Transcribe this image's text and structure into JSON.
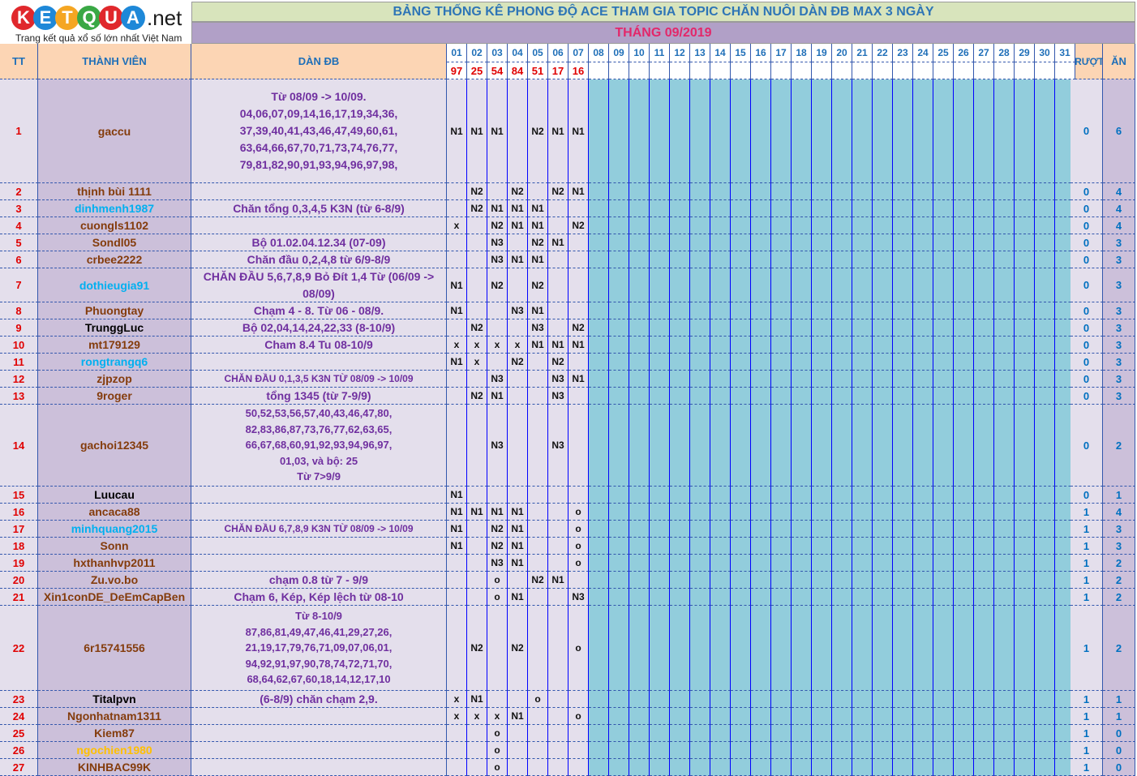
{
  "logo": {
    "letters": [
      {
        "ch": "K",
        "color": "#e0282c"
      },
      {
        "ch": "E",
        "color": "#1e88d8"
      },
      {
        "ch": "T",
        "color": "#f5a623"
      },
      {
        "ch": "Q",
        "color": "#3aa845"
      },
      {
        "ch": "U",
        "color": "#e0282c"
      },
      {
        "ch": "A",
        "color": "#1e88d8"
      }
    ],
    "suffix": ".net",
    "tagline": "Trang kết quả xổ số lớn nhất Việt Nam"
  },
  "title": "BẢNG THỐNG KÊ PHONG ĐỘ ACE THAM GIA TOPIC CHĂN NUÔI DÀN ĐB MAX 3 NGÀY",
  "subtitle": "THÁNG 09/2019",
  "headers": {
    "tt": "TT",
    "member": "THÀNH VIÊN",
    "dan": "DÀN ĐB",
    "truot": "TRƯỢT",
    "an": "ĂN"
  },
  "days": [
    "01",
    "02",
    "03",
    "04",
    "05",
    "06",
    "07",
    "08",
    "09",
    "10",
    "11",
    "12",
    "13",
    "14",
    "15",
    "16",
    "17",
    "18",
    "19",
    "20",
    "21",
    "22",
    "23",
    "24",
    "25",
    "26",
    "27",
    "28",
    "29",
    "30",
    "31"
  ],
  "results": [
    "97",
    "25",
    "54",
    "84",
    "51",
    "17",
    "16"
  ],
  "rows": [
    {
      "tt": "1",
      "name": "gaccu",
      "color": "#843c0c",
      "dan": "Từ 08/09 -> 10/09.\n04,06,07,09,14,16,17,19,34,36,\n37,39,40,41,43,46,47,49,60,61,\n63,64,66,67,70,71,73,74,76,77,\n79,81,82,90,91,93,94,96,97,98,",
      "days": [
        "N1",
        "N1",
        "N1",
        "",
        "N2",
        "N1",
        "N1"
      ],
      "truot": "0",
      "an": "6"
    },
    {
      "tt": "2",
      "name": "thịnh bùi 1111",
      "color": "#843c0c",
      "dan": "",
      "days": [
        "",
        "N2",
        "",
        "N2",
        "",
        "N2",
        "N1"
      ],
      "truot": "0",
      "an": "4"
    },
    {
      "tt": "3",
      "name": "dinhmenh1987",
      "color": "#00b0f0",
      "dan": "Chăn tổng 0,3,4,5 K3N (từ 6-8/9)",
      "days": [
        "",
        "N2",
        "N1",
        "N1",
        "N1",
        "",
        ""
      ],
      "truot": "0",
      "an": "4"
    },
    {
      "tt": "4",
      "name": "cuongls1102",
      "color": "#843c0c",
      "dan": "",
      "days": [
        "x",
        "",
        "N2",
        "N1",
        "N1",
        "",
        "N2"
      ],
      "truot": "0",
      "an": "4"
    },
    {
      "tt": "5",
      "name": "Sondl05",
      "color": "#843c0c",
      "dan": "Bộ 01.02.04.12.34 (07-09)",
      "days": [
        "",
        "",
        "N3",
        "",
        "N2",
        "N1",
        ""
      ],
      "truot": "0",
      "an": "3"
    },
    {
      "tt": "6",
      "name": "crbee2222",
      "color": "#843c0c",
      "dan": "Chăn đầu 0,2,4,8 từ 6/9-8/9",
      "days": [
        "",
        "",
        "N3",
        "N1",
        "N1",
        "",
        ""
      ],
      "truot": "0",
      "an": "3"
    },
    {
      "tt": "7",
      "name": "dothieugia91",
      "color": "#00b0f0",
      "dan": "CHĂN ĐẦU 5,6,7,8,9 Bỏ Đít 1,4 Từ (06/09 ->\n08/09)",
      "days": [
        "N1",
        "",
        "N2",
        "",
        "N2",
        "",
        ""
      ],
      "truot": "0",
      "an": "3"
    },
    {
      "tt": "8",
      "name": "Phuongtay",
      "color": "#843c0c",
      "dan": "Chạm 4 - 8. Từ 06 - 08/9.",
      "days": [
        "N1",
        "",
        "",
        "N3",
        "N1",
        "",
        ""
      ],
      "truot": "0",
      "an": "3"
    },
    {
      "tt": "9",
      "name": "TrunggLuc",
      "color": "#000000",
      "dan": "Bộ 02,04,14,24,22,33 (8-10/9)",
      "days": [
        "",
        "N2",
        "",
        "",
        "N3",
        "",
        "N2"
      ],
      "truot": "0",
      "an": "3"
    },
    {
      "tt": "10",
      "name": "mt179129",
      "color": "#843c0c",
      "dan": "Cham 8.4 Tu 08-10/9",
      "days": [
        "x",
        "x",
        "x",
        "x",
        "N1",
        "N1",
        "N1"
      ],
      "truot": "0",
      "an": "3"
    },
    {
      "tt": "11",
      "name": "rongtrangq6",
      "color": "#00b0f0",
      "dan": "",
      "days": [
        "N1",
        "x",
        "",
        "N2",
        "",
        "N2",
        ""
      ],
      "truot": "0",
      "an": "3"
    },
    {
      "tt": "12",
      "name": "zjpzop",
      "color": "#843c0c",
      "dan": "CHĂN ĐẦU 0,1,3,5 K3N TỪ 08/09 -> 10/09",
      "days": [
        "",
        "",
        "N3",
        "",
        "",
        "N3",
        "N1"
      ],
      "truot": "0",
      "an": "3"
    },
    {
      "tt": "13",
      "name": "9roger",
      "color": "#843c0c",
      "dan": "tổng 1345 (từ 7-9/9)",
      "days": [
        "",
        "N2",
        "N1",
        "",
        "",
        "N3",
        ""
      ],
      "truot": "0",
      "an": "3"
    },
    {
      "tt": "14",
      "name": "gachoi12345",
      "color": "#843c0c",
      "dan": "50,52,53,56,57,40,43,46,47,80,\n82,83,86,87,73,76,77,62,63,65,\n66,67,68,60,91,92,93,94,96,97,\n01,03, và bộ: 25\nTừ 7>9/9",
      "days": [
        "",
        "",
        "N3",
        "",
        "",
        "N3",
        ""
      ],
      "truot": "0",
      "an": "2"
    },
    {
      "tt": "15",
      "name": "Luucau",
      "color": "#000000",
      "dan": "",
      "days": [
        "N1",
        "",
        "",
        "",
        "",
        "",
        ""
      ],
      "truot": "0",
      "an": "1"
    },
    {
      "tt": "16",
      "name": "ancaca88",
      "color": "#843c0c",
      "dan": "",
      "days": [
        "N1",
        "N1",
        "N1",
        "N1",
        "",
        "",
        "o"
      ],
      "truot": "1",
      "an": "4"
    },
    {
      "tt": "17",
      "name": "minhquang2015",
      "color": "#00b0f0",
      "dan": "CHĂN ĐẦU 6,7,8,9 K3N TỪ 08/09 -> 10/09",
      "days": [
        "N1",
        "",
        "N2",
        "N1",
        "",
        "",
        "o"
      ],
      "truot": "1",
      "an": "3"
    },
    {
      "tt": "18",
      "name": "Sonn",
      "color": "#843c0c",
      "dan": "",
      "days": [
        "N1",
        "",
        "N2",
        "N1",
        "",
        "",
        "o"
      ],
      "truot": "1",
      "an": "3"
    },
    {
      "tt": "19",
      "name": "hxthanhvp2011",
      "color": "#843c0c",
      "dan": "",
      "days": [
        "",
        "",
        "N3",
        "N1",
        "",
        "",
        "o"
      ],
      "truot": "1",
      "an": "2"
    },
    {
      "tt": "20",
      "name": "Zu.vo.bo",
      "color": "#843c0c",
      "dan": "chạm 0.8 từ 7 - 9/9",
      "days": [
        "",
        "",
        "o",
        "",
        "N2",
        "N1",
        ""
      ],
      "truot": "1",
      "an": "2"
    },
    {
      "tt": "21",
      "name": "Xin1conDE_DeEmCapBen",
      "color": "#843c0c",
      "dan": "Chạm 6, Kép, Kép lệch từ 08-10",
      "days": [
        "",
        "",
        "o",
        "N1",
        "",
        "",
        "N3"
      ],
      "truot": "1",
      "an": "2"
    },
    {
      "tt": "22",
      "name": "6r15741556",
      "color": "#843c0c",
      "dan": "Từ 8-10/9\n87,86,81,49,47,46,41,29,27,26,\n21,19,17,79,76,71,09,07,06,01,\n94,92,91,97,90,78,74,72,71,70,\n68,64,62,67,60,18,14,12,17,10",
      "days": [
        "",
        "N2",
        "",
        "N2",
        "",
        "",
        "o"
      ],
      "truot": "1",
      "an": "2"
    },
    {
      "tt": "23",
      "name": "Titalpvn",
      "color": "#000000",
      "dan": "(6-8/9) chăn chạm 2,9.",
      "days": [
        "x",
        "N1",
        "",
        "",
        "o",
        "",
        ""
      ],
      "truot": "1",
      "an": "1"
    },
    {
      "tt": "24",
      "name": "Ngonhatnam1311",
      "color": "#843c0c",
      "dan": "",
      "days": [
        "x",
        "x",
        "x",
        "N1",
        "",
        "",
        "o"
      ],
      "truot": "1",
      "an": "1"
    },
    {
      "tt": "25",
      "name": "Kiem87",
      "color": "#843c0c",
      "dan": "",
      "days": [
        "",
        "",
        "o",
        "",
        "",
        "",
        ""
      ],
      "truot": "1",
      "an": "0"
    },
    {
      "tt": "26",
      "name": "ngochien1980",
      "color": "#ffc000",
      "dan": "",
      "days": [
        "",
        "",
        "o",
        "",
        "",
        "",
        ""
      ],
      "truot": "1",
      "an": "0"
    },
    {
      "tt": "27",
      "name": "KINHBAC99K",
      "color": "#843c0c",
      "dan": "",
      "days": [
        "",
        "",
        "o",
        "",
        "",
        "",
        ""
      ],
      "truot": "1",
      "an": "0"
    }
  ]
}
